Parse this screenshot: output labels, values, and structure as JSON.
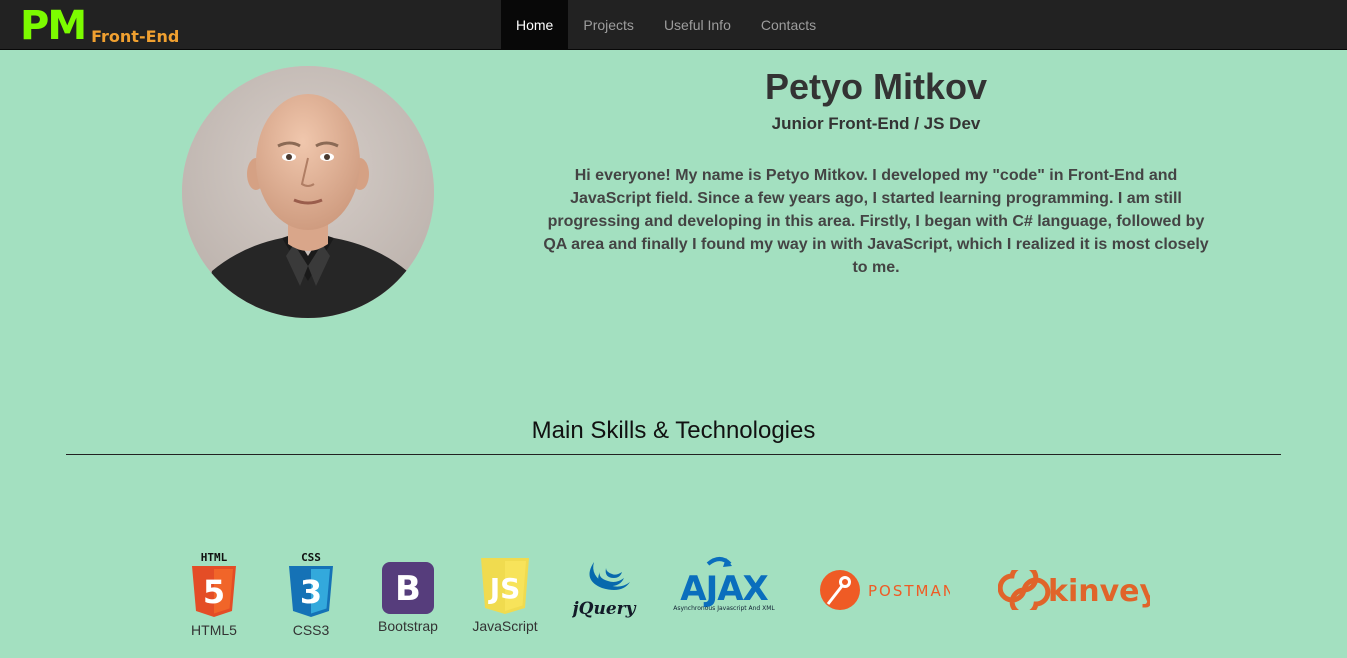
{
  "brand": {
    "pm": "PM",
    "sub": "Front-End"
  },
  "nav": {
    "items": [
      {
        "label": "Home",
        "active": true
      },
      {
        "label": "Projects",
        "active": false
      },
      {
        "label": "Useful Info",
        "active": false
      },
      {
        "label": "Contacts",
        "active": false
      }
    ]
  },
  "profile": {
    "name": "Petyo Mitkov",
    "title": "Junior Front-End / JS Dev",
    "bio": "Hi everyone! My name is Petyo Mitkov. I developed my \"code\" in Front-End and JavaScript field. Since a few years ago, I started learning programming. I am still progressing and developing in this area. Firstly, I began with C# language, followed by QA area and finally I found my way in with JavaScript, which I realized it is most closely to me."
  },
  "skills": {
    "title": "Main Skills & Technologies",
    "items": [
      {
        "label": "HTML5",
        "badge": "HTML",
        "glyph": "5",
        "color": "#e44d26"
      },
      {
        "label": "CSS3",
        "badge": "CSS",
        "glyph": "3",
        "color": "#2965f1"
      },
      {
        "label": "Bootstrap",
        "glyph": "B",
        "color": "#563d7c"
      },
      {
        "label": "JavaScript",
        "glyph": "JS",
        "color": "#f0db4f"
      },
      {
        "label": "",
        "logo_text": "jQuery",
        "color": "#0769ad"
      },
      {
        "label": "",
        "logo_text": "AJAX",
        "tagline": "Asynchronous Javascript And XML",
        "color": "#0a6ebd"
      },
      {
        "label": "",
        "logo_text": "POSTMAN",
        "color": "#ef5b25"
      },
      {
        "label": "",
        "logo_text": "kinvey",
        "color": "#e0642a"
      }
    ]
  }
}
